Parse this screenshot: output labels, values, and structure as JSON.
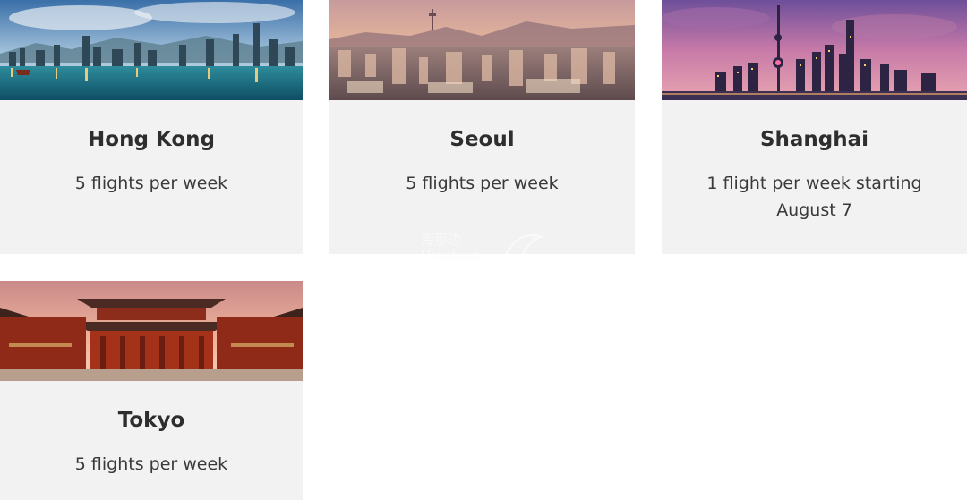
{
  "cards": [
    {
      "city": "Hong Kong",
      "frequency": "5 flights per week",
      "image": "hong-kong-skyline-photo"
    },
    {
      "city": "Seoul",
      "frequency": "5 flights per week",
      "image": "seoul-cityscape-photo"
    },
    {
      "city": "Shanghai",
      "frequency": "1 flight per week starting August 7",
      "image": "shanghai-skyline-photo"
    },
    {
      "city": "Tokyo",
      "frequency": "5 flights per week",
      "image": "tokyo-temple-gate-photo"
    }
  ],
  "watermark": {
    "line1": "海那边",
    "line2": "Hinabian"
  },
  "colors": {
    "card_bg": "#f2f2f2",
    "text": "#2e2e2e",
    "page_bg": "#ffffff"
  }
}
